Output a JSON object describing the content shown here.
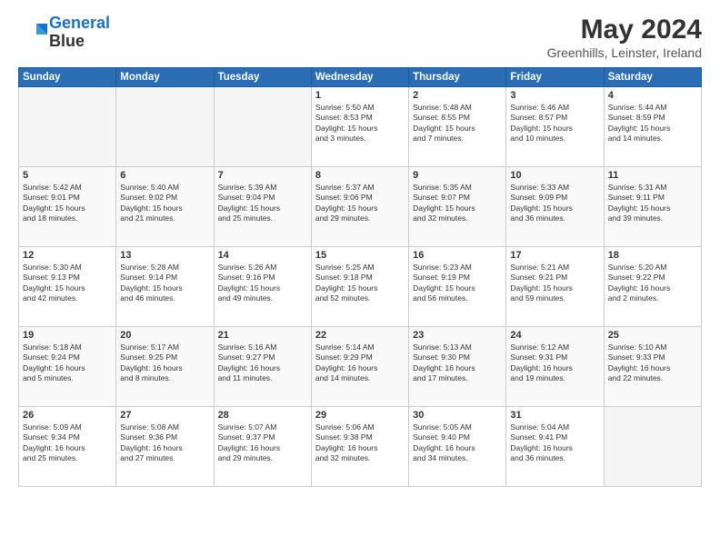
{
  "header": {
    "logo_line1": "General",
    "logo_line2": "Blue",
    "title": "May 2024",
    "subtitle": "Greenhills, Leinster, Ireland"
  },
  "weekdays": [
    "Sunday",
    "Monday",
    "Tuesday",
    "Wednesday",
    "Thursday",
    "Friday",
    "Saturday"
  ],
  "weeks": [
    [
      {
        "day": "",
        "info": ""
      },
      {
        "day": "",
        "info": ""
      },
      {
        "day": "",
        "info": ""
      },
      {
        "day": "1",
        "info": "Sunrise: 5:50 AM\nSunset: 8:53 PM\nDaylight: 15 hours\nand 3 minutes."
      },
      {
        "day": "2",
        "info": "Sunrise: 5:48 AM\nSunset: 8:55 PM\nDaylight: 15 hours\nand 7 minutes."
      },
      {
        "day": "3",
        "info": "Sunrise: 5:46 AM\nSunset: 8:57 PM\nDaylight: 15 hours\nand 10 minutes."
      },
      {
        "day": "4",
        "info": "Sunrise: 5:44 AM\nSunset: 8:59 PM\nDaylight: 15 hours\nand 14 minutes."
      }
    ],
    [
      {
        "day": "5",
        "info": "Sunrise: 5:42 AM\nSunset: 9:01 PM\nDaylight: 15 hours\nand 18 minutes."
      },
      {
        "day": "6",
        "info": "Sunrise: 5:40 AM\nSunset: 9:02 PM\nDaylight: 15 hours\nand 21 minutes."
      },
      {
        "day": "7",
        "info": "Sunrise: 5:39 AM\nSunset: 9:04 PM\nDaylight: 15 hours\nand 25 minutes."
      },
      {
        "day": "8",
        "info": "Sunrise: 5:37 AM\nSunset: 9:06 PM\nDaylight: 15 hours\nand 29 minutes."
      },
      {
        "day": "9",
        "info": "Sunrise: 5:35 AM\nSunset: 9:07 PM\nDaylight: 15 hours\nand 32 minutes."
      },
      {
        "day": "10",
        "info": "Sunrise: 5:33 AM\nSunset: 9:09 PM\nDaylight: 15 hours\nand 36 minutes."
      },
      {
        "day": "11",
        "info": "Sunrise: 5:31 AM\nSunset: 9:11 PM\nDaylight: 15 hours\nand 39 minutes."
      }
    ],
    [
      {
        "day": "12",
        "info": "Sunrise: 5:30 AM\nSunset: 9:13 PM\nDaylight: 15 hours\nand 42 minutes."
      },
      {
        "day": "13",
        "info": "Sunrise: 5:28 AM\nSunset: 9:14 PM\nDaylight: 15 hours\nand 46 minutes."
      },
      {
        "day": "14",
        "info": "Sunrise: 5:26 AM\nSunset: 9:16 PM\nDaylight: 15 hours\nand 49 minutes."
      },
      {
        "day": "15",
        "info": "Sunrise: 5:25 AM\nSunset: 9:18 PM\nDaylight: 15 hours\nand 52 minutes."
      },
      {
        "day": "16",
        "info": "Sunrise: 5:23 AM\nSunset: 9:19 PM\nDaylight: 15 hours\nand 56 minutes."
      },
      {
        "day": "17",
        "info": "Sunrise: 5:21 AM\nSunset: 9:21 PM\nDaylight: 15 hours\nand 59 minutes."
      },
      {
        "day": "18",
        "info": "Sunrise: 5:20 AM\nSunset: 9:22 PM\nDaylight: 16 hours\nand 2 minutes."
      }
    ],
    [
      {
        "day": "19",
        "info": "Sunrise: 5:18 AM\nSunset: 9:24 PM\nDaylight: 16 hours\nand 5 minutes."
      },
      {
        "day": "20",
        "info": "Sunrise: 5:17 AM\nSunset: 9:25 PM\nDaylight: 16 hours\nand 8 minutes."
      },
      {
        "day": "21",
        "info": "Sunrise: 5:16 AM\nSunset: 9:27 PM\nDaylight: 16 hours\nand 11 minutes."
      },
      {
        "day": "22",
        "info": "Sunrise: 5:14 AM\nSunset: 9:29 PM\nDaylight: 16 hours\nand 14 minutes."
      },
      {
        "day": "23",
        "info": "Sunrise: 5:13 AM\nSunset: 9:30 PM\nDaylight: 16 hours\nand 17 minutes."
      },
      {
        "day": "24",
        "info": "Sunrise: 5:12 AM\nSunset: 9:31 PM\nDaylight: 16 hours\nand 19 minutes."
      },
      {
        "day": "25",
        "info": "Sunrise: 5:10 AM\nSunset: 9:33 PM\nDaylight: 16 hours\nand 22 minutes."
      }
    ],
    [
      {
        "day": "26",
        "info": "Sunrise: 5:09 AM\nSunset: 9:34 PM\nDaylight: 16 hours\nand 25 minutes."
      },
      {
        "day": "27",
        "info": "Sunrise: 5:08 AM\nSunset: 9:36 PM\nDaylight: 16 hours\nand 27 minutes."
      },
      {
        "day": "28",
        "info": "Sunrise: 5:07 AM\nSunset: 9:37 PM\nDaylight: 16 hours\nand 29 minutes."
      },
      {
        "day": "29",
        "info": "Sunrise: 5:06 AM\nSunset: 9:38 PM\nDaylight: 16 hours\nand 32 minutes."
      },
      {
        "day": "30",
        "info": "Sunrise: 5:05 AM\nSunset: 9:40 PM\nDaylight: 16 hours\nand 34 minutes."
      },
      {
        "day": "31",
        "info": "Sunrise: 5:04 AM\nSunset: 9:41 PM\nDaylight: 16 hours\nand 36 minutes."
      },
      {
        "day": "",
        "info": ""
      }
    ]
  ]
}
